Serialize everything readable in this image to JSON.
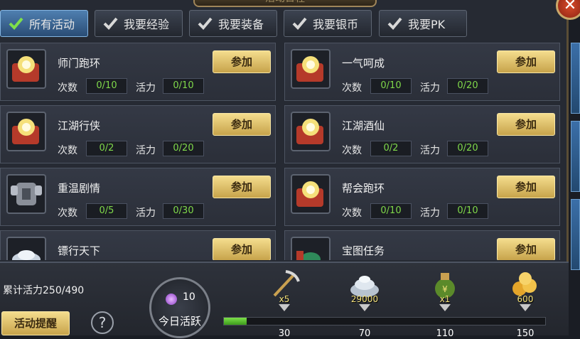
{
  "header": {
    "title": "活动日程",
    "close_label": "✕"
  },
  "tabs": [
    {
      "label": "所有活动",
      "active": true
    },
    {
      "label": "我要经验",
      "active": false
    },
    {
      "label": "我要装备",
      "active": false
    },
    {
      "label": "我要银币",
      "active": false
    },
    {
      "label": "我要PK",
      "active": false
    }
  ],
  "labels": {
    "count": "次数",
    "vitality": "活力",
    "join": "参加"
  },
  "activities": [
    {
      "name": "师门跑环",
      "count": "0/10",
      "vitality": "0/10",
      "icon": "scroll-orb-icon"
    },
    {
      "name": "一气呵成",
      "count": "0/10",
      "vitality": "0/20",
      "icon": "scroll-orb-icon"
    },
    {
      "name": "江湖行侠",
      "count": "0/2",
      "vitality": "0/20",
      "icon": "scroll-orb-icon"
    },
    {
      "name": "江湖酒仙",
      "count": "0/2",
      "vitality": "0/20",
      "icon": "scroll-orb-icon"
    },
    {
      "name": "重温剧情",
      "count": "0/5",
      "vitality": "0/30",
      "icon": "armor-icon"
    },
    {
      "name": "帮会跑环",
      "count": "0/10",
      "vitality": "0/10",
      "icon": "scroll-orb-icon"
    },
    {
      "name": "镖行天下",
      "count": "",
      "vitality": "",
      "icon": "silver-ingot-icon"
    },
    {
      "name": "宝图任务",
      "count": "",
      "vitality": "",
      "icon": "treasure-map-icon"
    }
  ],
  "footer": {
    "accumulated": "累计活力250/490",
    "remind_label": "活动提醒",
    "help_label": "?",
    "daily_count": "10",
    "daily_label": "今日活跃",
    "progress_fraction": 0.07,
    "rewards": [
      {
        "qty": "x5",
        "milestone": "30",
        "icon": "pickaxe-icon"
      },
      {
        "qty": "29000",
        "milestone": "70",
        "icon": "silver-pile-icon"
      },
      {
        "qty": "x1",
        "milestone": "110",
        "icon": "money-bag-icon"
      },
      {
        "qty": "600",
        "milestone": "150",
        "icon": "gold-coins-icon"
      }
    ]
  },
  "colors": {
    "accent_gold": "#c7a34b",
    "value_green": "#7fd84a",
    "tab_active": "#2a4d75"
  }
}
